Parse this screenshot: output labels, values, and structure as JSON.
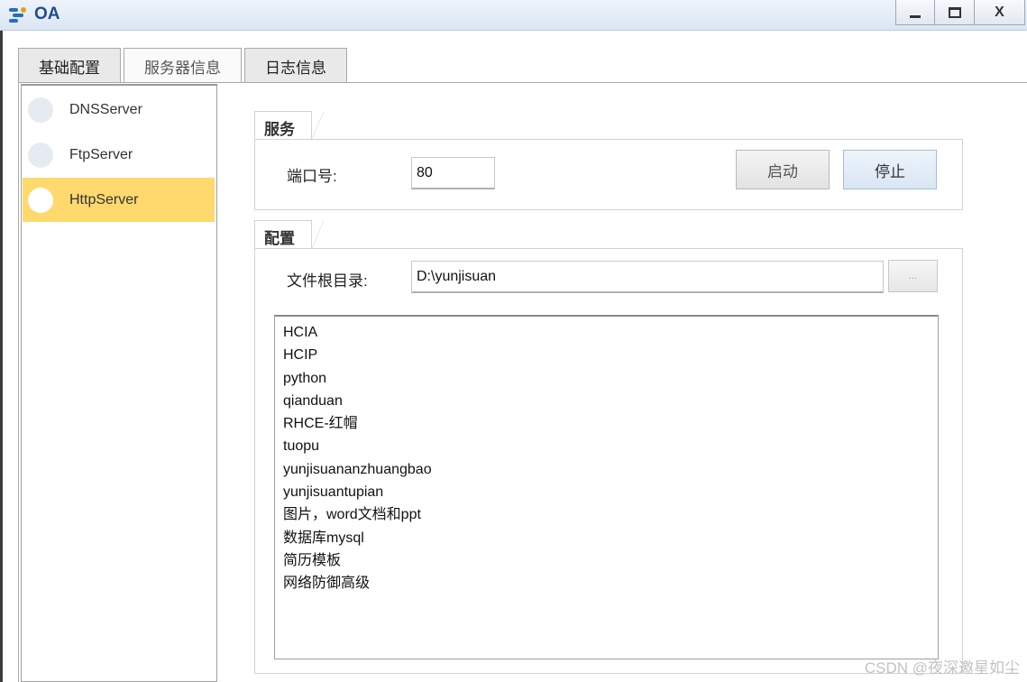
{
  "window": {
    "title": "OA",
    "close_label": "X"
  },
  "tabs": [
    "基础配置",
    "服务器信息",
    "日志信息"
  ],
  "servers": [
    "DNSServer",
    "FtpServer",
    "HttpServer"
  ],
  "selected_server": "HttpServer",
  "service_group": {
    "title": "服务",
    "port_label": "端口号:",
    "port_value": "80",
    "start_label": "启动",
    "stop_label": "停止"
  },
  "config_group": {
    "title": "配置",
    "root_label": "文件根目录:",
    "root_value": "D:\\yunjisuan",
    "browse_label": "...",
    "files": [
      "HCIA",
      "HCIP",
      "python",
      "qianduan",
      "RHCE-红帽",
      "tuopu",
      "yunjisuananzhuangbao",
      "yunjisuantupian",
      "图片，word文档和ppt",
      "数据库mysql",
      "简历模板",
      "网络防御高级"
    ]
  },
  "watermark": "CSDN @夜深邀星如尘",
  "colors": {
    "selected_item": "#ffd96e",
    "titlebar": "#dbe6f3",
    "accent": "#1f4e8c"
  }
}
